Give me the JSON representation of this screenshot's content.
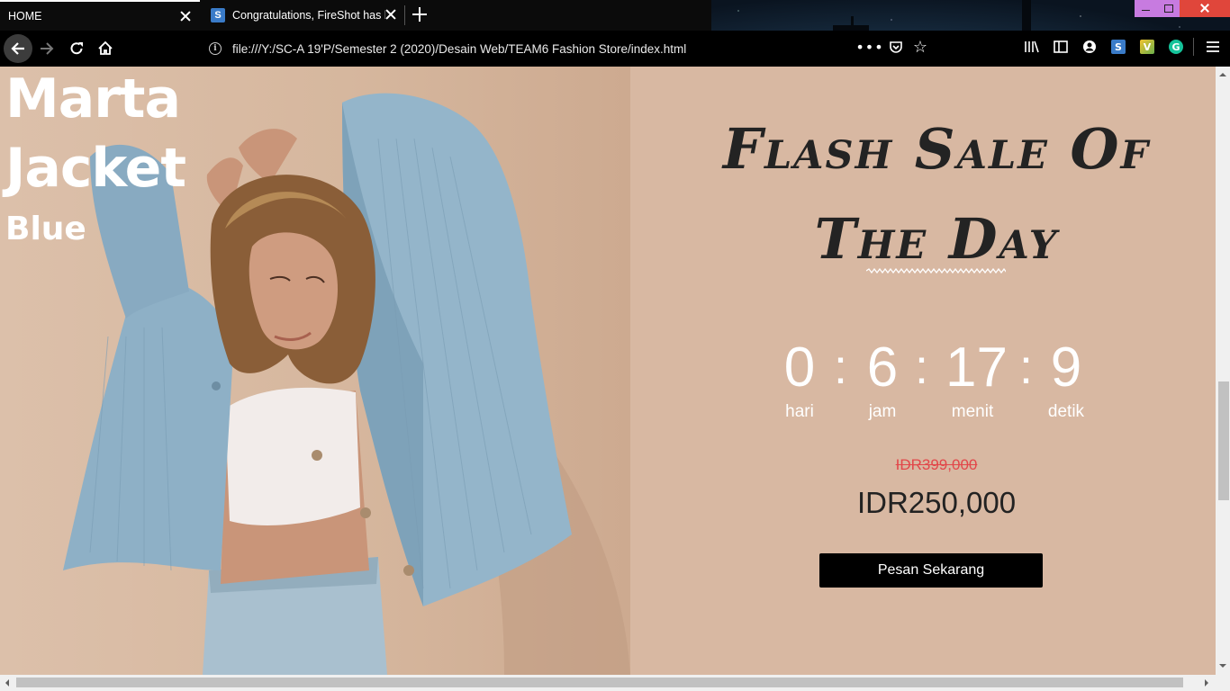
{
  "browser": {
    "tabs": [
      {
        "title": "HOME",
        "active": true
      },
      {
        "title": "Congratulations, FireShot has been",
        "active": false
      }
    ],
    "url": "file:///Y:/SC-A 19'P/Semester 2 (2020)/Desain Web/TEAM6 Fashion Store/index.html"
  },
  "hero": {
    "line1": "Marta",
    "line2": "Jacket",
    "line3": "Blue"
  },
  "sale": {
    "heading_line1": "Flash Sale Of",
    "heading_line2": "The Day",
    "countdown": [
      {
        "value": "0",
        "label": "hari"
      },
      {
        "value": "6",
        "label": "jam"
      },
      {
        "value": "17",
        "label": "menit"
      },
      {
        "value": "9",
        "label": "detik"
      }
    ],
    "separator": ":",
    "old_price": "IDR399,000",
    "new_price": "IDR250,000",
    "button_label": "Pesan Sekarang"
  },
  "colors": {
    "page_bg": "#d8b8a2",
    "heading": "#232323",
    "old_price": "#e2474a",
    "button_bg": "#000000"
  }
}
